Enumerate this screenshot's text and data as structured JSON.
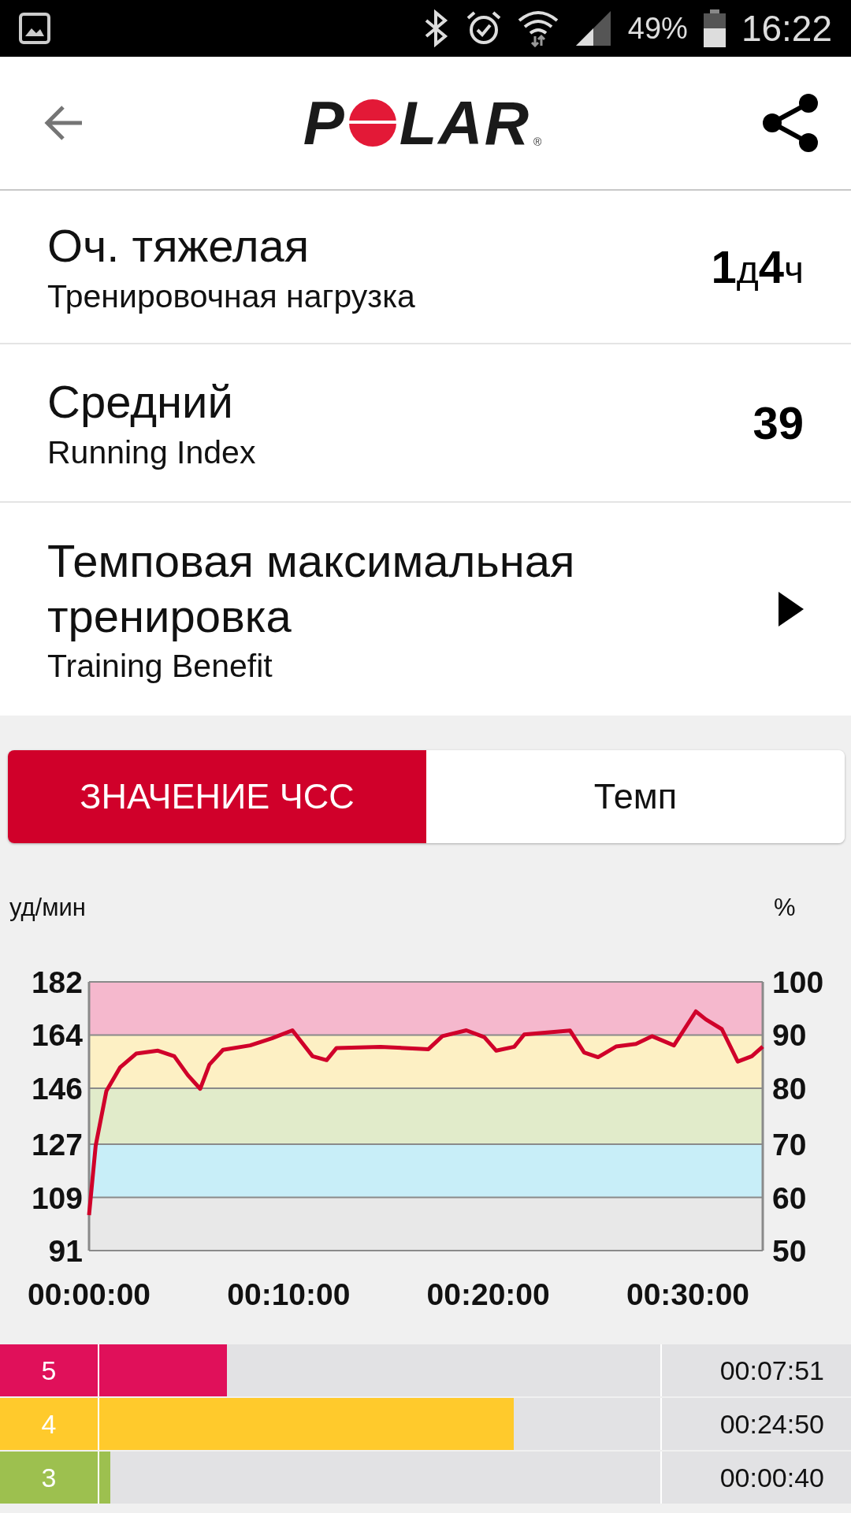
{
  "status_bar": {
    "battery": "49%",
    "time": "16:22"
  },
  "header": {
    "logo_left": "P",
    "logo_right": "LAR",
    "logo_mark": "®"
  },
  "metrics": [
    {
      "title": "Оч. тяжелая",
      "subtitle": "Тренировочная нагрузка",
      "value": "**1**д**4**ч",
      "kind": "value"
    },
    {
      "title": "Средний",
      "subtitle": "Running Index",
      "value": "**39**",
      "kind": "value"
    },
    {
      "title": "Темповая максимальная тренировка",
      "subtitle": "Training Benefit",
      "kind": "link"
    }
  ],
  "tabs": [
    {
      "label": "ЗНАЧЕНИЕ ЧСС",
      "selected": true
    },
    {
      "label": "Темп",
      "selected": false
    }
  ],
  "chart_data": {
    "type": "line",
    "ylabel": "уд/мин",
    "y2label": "%",
    "xlim": [
      0,
      33.75
    ],
    "ylim": [
      91,
      182
    ],
    "xticks": [
      {
        "value": 0,
        "label": "00:00:00"
      },
      {
        "value": 10,
        "label": "00:10:00"
      },
      {
        "value": 20,
        "label": "00:20:00"
      },
      {
        "value": 30,
        "label": "00:30:00"
      }
    ],
    "yticks": [
      91,
      109,
      127,
      146,
      164,
      182
    ],
    "y2ticks": [
      "50",
      "60",
      "70",
      "80",
      "90",
      "100"
    ],
    "x": [
      0,
      0.33,
      0.87,
      1.55,
      2.36,
      3.45,
      4.27,
      4.95,
      5.57,
      6.03,
      6.71,
      8.07,
      9.16,
      10.19,
      11.2,
      11.9,
      12.4,
      14.6,
      17,
      17.7,
      18.9,
      19.8,
      20.4,
      21.3,
      21.8,
      24.1,
      24.8,
      25.5,
      26.4,
      27.4,
      28.2,
      29.3,
      30.4,
      30.9,
      31.7,
      32.5,
      33.2,
      33.75
    ],
    "series": [
      {
        "color": "#d0002a",
        "values": [
          103,
          126.5,
          145,
          153,
          157.7,
          158.7,
          156.8,
          150.4,
          145.8,
          154,
          159,
          160.5,
          162.9,
          165.6,
          156.8,
          155.5,
          159.6,
          160,
          159.2,
          163.6,
          165.6,
          163.3,
          158.7,
          160,
          164.2,
          165.5,
          158.1,
          156.5,
          160.1,
          161,
          163.6,
          160.5,
          172,
          169.3,
          166,
          155,
          156.8,
          160.1
        ]
      }
    ],
    "grid": true,
    "bands": [
      {
        "axis": "y",
        "from": 91,
        "to": 109,
        "color": "#e8e8e8"
      },
      {
        "axis": "y",
        "from": 109,
        "to": 127,
        "color": "#c8eef8"
      },
      {
        "axis": "y",
        "from": 127,
        "to": 146,
        "color": "#e1ebca"
      },
      {
        "axis": "y",
        "from": 146,
        "to": 164,
        "color": "#fdf0c4"
      },
      {
        "axis": "y",
        "from": 164,
        "to": 182,
        "color": "#f5b8cd"
      }
    ]
  },
  "zones": [
    {
      "zone": "5",
      "color": "#e0105a",
      "level": 0.228,
      "time": "00:07:51"
    },
    {
      "zone": "4",
      "color": "#ffca2c",
      "level": 0.739,
      "time": "00:24:50"
    },
    {
      "zone": "3",
      "color": "#9dc04f",
      "level": 0.02,
      "time": "00:00:40"
    }
  ]
}
